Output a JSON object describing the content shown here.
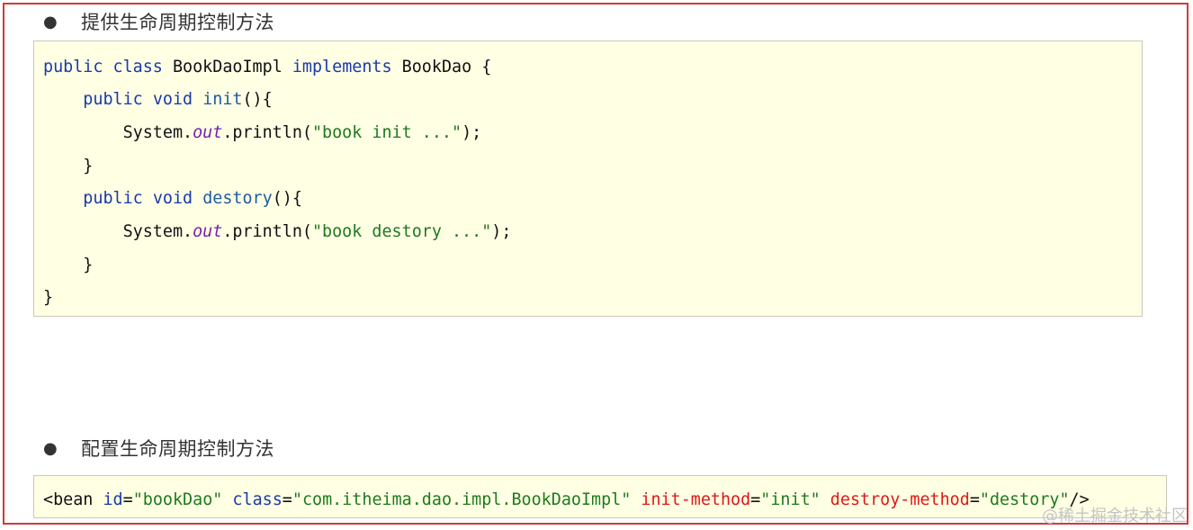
{
  "section1": {
    "bullet": "●",
    "heading": "提供生命周期控制方法",
    "code": {
      "l1_kw1": "public",
      "l1_kw2": "class",
      "l1_name": "BookDaoImpl",
      "l1_kw3": "implements",
      "l1_iface": "BookDao {",
      "l2_kw1": "public",
      "l2_kw2": "void",
      "l2_fn": "init",
      "l2_rest": "(){",
      "l3_a": "System.",
      "l3_field": "out",
      "l3_b": ".println(",
      "l3_str": "\"book init ...\"",
      "l3_c": ");",
      "l4": "}",
      "l5_kw1": "public",
      "l5_kw2": "void",
      "l5_fn": "destory",
      "l5_rest": "(){",
      "l6_a": "System.",
      "l6_field": "out",
      "l6_b": ".println(",
      "l6_str": "\"book destory ...\"",
      "l6_c": ");",
      "l7": "}",
      "l8": "}"
    }
  },
  "section2": {
    "bullet": "●",
    "heading": "配置生命周期控制方法",
    "code": {
      "open": "<bean",
      "attr_id": "id",
      "val_id": "\"bookDao\"",
      "attr_class": "class",
      "val_class": "\"com.itheima.dao.impl.BookDaoImpl\"",
      "attr_init": "init-method",
      "val_init": "\"init\"",
      "attr_destroy": "destroy-method",
      "val_destroy": "\"destory\"",
      "close": "/>"
    }
  },
  "watermark": "@稀土掘金技术社区",
  "colors": {
    "border": "#d23a3a",
    "code_bg": "#ffffe4",
    "keyword": "#1a3aa8",
    "string": "#1e7a1e",
    "field": "#7a1fa8",
    "xml_attr_red": "#e01818"
  }
}
